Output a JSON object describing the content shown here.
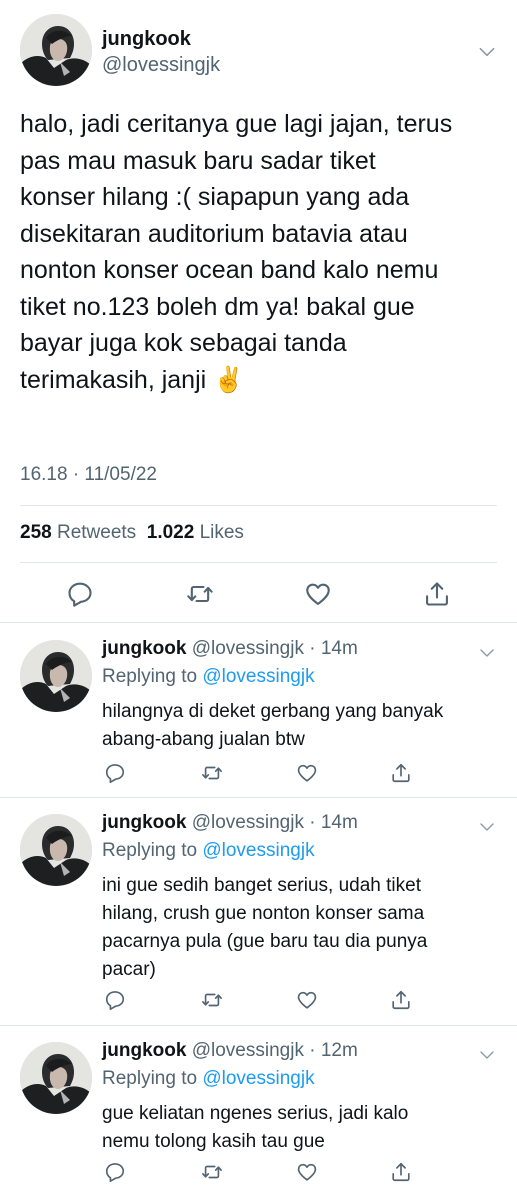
{
  "main_tweet": {
    "display_name": "jungkook",
    "handle": "@lovessingjk",
    "text": "halo, jadi ceritanya gue lagi jajan, terus\npas mau masuk baru sadar tiket\nkonser hilang :( siapapun yang ada\ndisekitaran auditorium batavia atau\nnonton konser ocean band kalo nemu\ntiket no.123 boleh dm ya! bakal gue\nbayar juga kok sebagai tanda\nterimakasih, janji ✌️",
    "timestamp": "16.18 · 11/05/22",
    "retweets_count": "258",
    "retweets_label": "Retweets",
    "likes_count": "1.022",
    "likes_label": "Likes"
  },
  "replies": [
    {
      "display_name": "jungkook",
      "handle_time": "@lovessingjk · 14m",
      "replying_prefix": "Replying to",
      "replying_to": "@lovessingjk",
      "text": "hilangnya di deket gerbang yang banyak\nabang-abang jualan btw"
    },
    {
      "display_name": "jungkook",
      "handle_time": "@lovessingjk · 14m",
      "replying_prefix": "Replying to",
      "replying_to": "@lovessingjk",
      "text": "ini gue sedih banget serius, udah tiket\nhilang, crush gue nonton konser sama\npacarnya pula (gue baru tau dia punya\npacar)"
    },
    {
      "display_name": "jungkook",
      "handle_time": "@lovessingjk · 12m",
      "replying_prefix": "Replying to",
      "replying_to": "@lovessingjk",
      "text": "gue keliatan ngenes serius, jadi kalo\nnemu tolong kasih tau gue"
    }
  ],
  "icons": {
    "reply": "reply-icon",
    "retweet": "retweet-icon",
    "like": "heart-icon",
    "share": "share-icon",
    "more": "chevron-down-icon"
  },
  "colors": {
    "text_primary": "#0f1419",
    "text_secondary": "#536471",
    "link": "#1d9bf0",
    "divider": "#e1e6ea"
  }
}
